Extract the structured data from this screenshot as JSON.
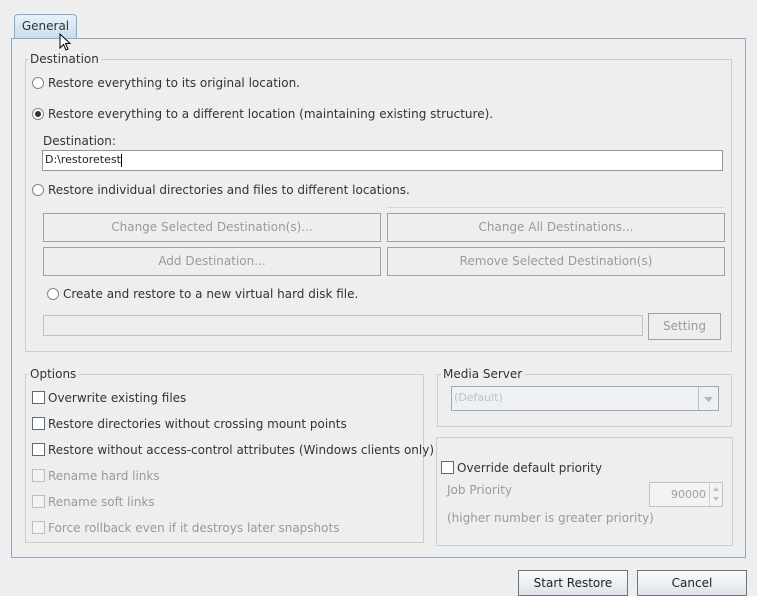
{
  "tabs": [
    {
      "label": "General"
    }
  ],
  "destination": {
    "legend": "Destination",
    "radio_original": "Restore everything to its original location.",
    "radio_different": "Restore everything to a different location (maintaining existing structure).",
    "destination_label": "Destination:",
    "destination_value": "D:\\restoretest",
    "radio_individual": "Restore individual directories and files to different locations.",
    "btn_change_selected": "Change Selected Destination(s)...",
    "btn_change_all": "Change All Destinations...",
    "btn_add": "Add Destination...",
    "btn_remove": "Remove Selected Destination(s)",
    "radio_vhd": "Create and restore to a new virtual hard disk file.",
    "vhd_path_value": "",
    "btn_setting": "Setting",
    "selected_option": "different"
  },
  "options": {
    "legend": "Options",
    "items": [
      {
        "label": "Overwrite existing files",
        "enabled": true,
        "checked": false
      },
      {
        "label": "Restore directories without crossing mount points",
        "enabled": true,
        "checked": false
      },
      {
        "label": "Restore without access-control attributes (Windows clients only)",
        "enabled": true,
        "checked": false
      },
      {
        "label": "Rename hard links",
        "enabled": false,
        "checked": false
      },
      {
        "label": "Rename soft links",
        "enabled": false,
        "checked": false
      },
      {
        "label": "Force rollback even if it destroys later snapshots",
        "enabled": false,
        "checked": false
      }
    ]
  },
  "media_server": {
    "legend": "Media Server",
    "selected": "(Default)"
  },
  "priority": {
    "override_label": "Override default priority",
    "override_checked": false,
    "job_priority_label": "Job Priority",
    "job_priority_value": "90000",
    "hint": "(higher number is greater priority)"
  },
  "footer": {
    "start_label": "Start Restore",
    "cancel_label": "Cancel"
  },
  "icons": {
    "mouse_cursor": "arrow-cursor-icon",
    "dropdown": "chevron-down-icon",
    "spinner": "spinner-arrows-icon"
  }
}
